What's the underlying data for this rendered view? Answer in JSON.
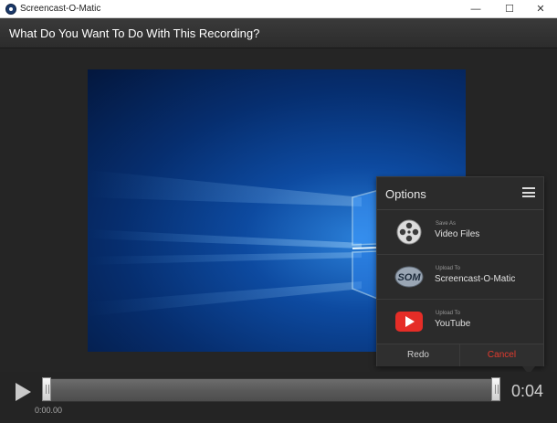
{
  "window": {
    "title": "Screencast-O-Matic",
    "controls": {
      "minimize": "—",
      "maximize": "☐",
      "close": "✕"
    }
  },
  "header": {
    "title": "What Do You Want To Do With This Recording?"
  },
  "options": {
    "title": "Options",
    "items": [
      {
        "small": "Save As",
        "label": "Video Files",
        "icon": "film-reel-icon"
      },
      {
        "small": "Upload To",
        "label": "Screencast-O-Matic",
        "icon": "som-logo-icon"
      },
      {
        "small": "Upload To",
        "label": "YouTube",
        "icon": "youtube-icon"
      }
    ],
    "redo_label": "Redo",
    "cancel_label": "Cancel"
  },
  "player": {
    "start_time": "0:00.00",
    "total_time": "0:04"
  },
  "colors": {
    "cancel": "#e33b2f",
    "youtube": "#e52d27",
    "preview_blue": "#0d4aa0"
  }
}
